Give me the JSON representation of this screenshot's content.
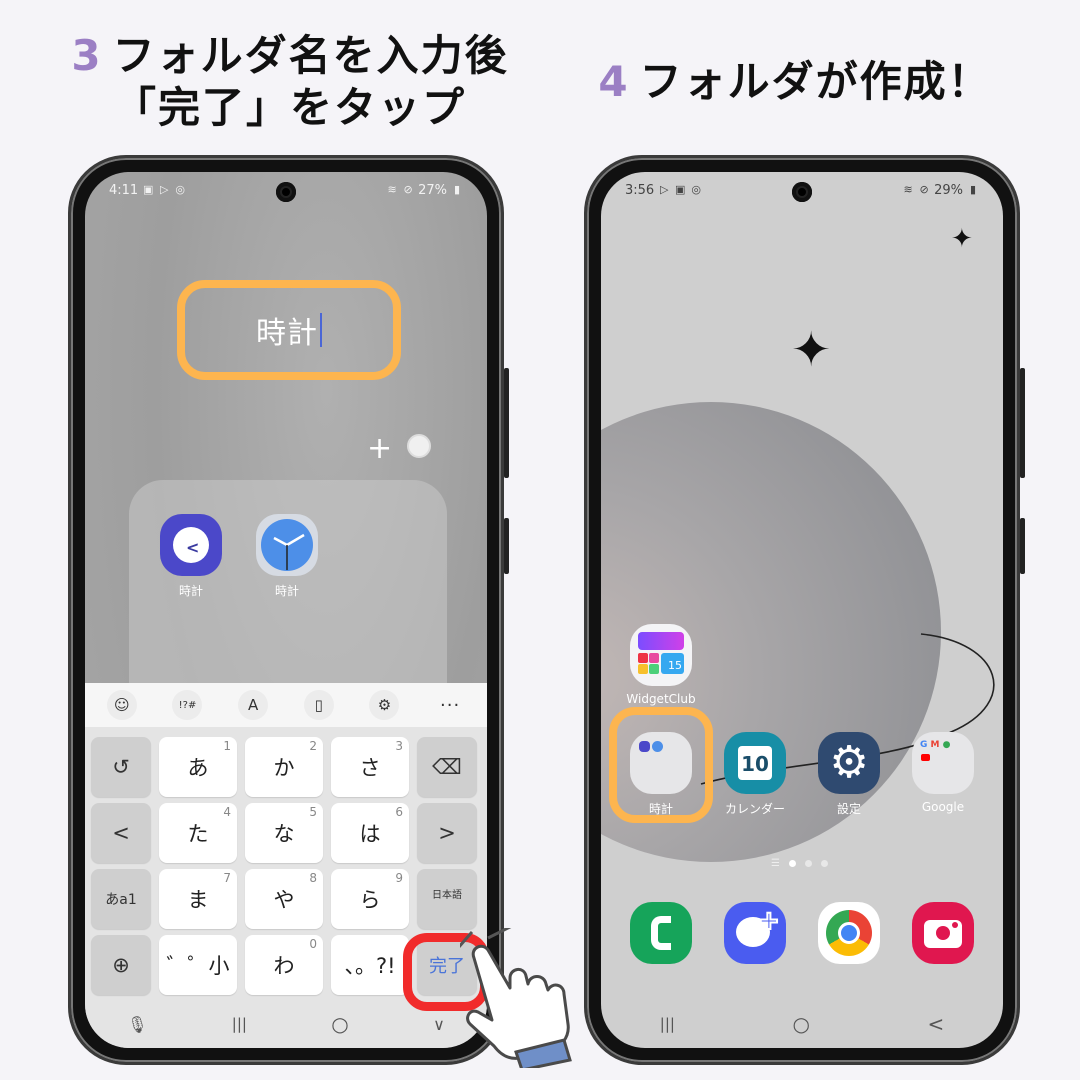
{
  "steps": [
    {
      "number": "3",
      "title_line1": "フォルダ名を入力後",
      "title_line2": "「完了」をタップ"
    },
    {
      "number": "4",
      "title": "フォルダが作成！"
    }
  ],
  "colors": {
    "accent_number": "#9b7fc4",
    "highlight_orange": "#fdb54f",
    "highlight_red": "#f12b2b",
    "key_done_blue": "#4a74d8"
  },
  "left_phone": {
    "status": {
      "time": "4:11",
      "left_icons": [
        "gallery-icon",
        "play-store-icon",
        "alarm-icon"
      ],
      "right_icons": [
        "wifi-icon",
        "do-not-disturb-icon"
      ],
      "battery": "27%"
    },
    "folder_name_input": {
      "value": "時計"
    },
    "folder_controls": {
      "add": "+",
      "color": "color-picker"
    },
    "folder_apps": [
      {
        "label": "時計",
        "icon": "samsung-clock-icon"
      },
      {
        "label": "時計",
        "icon": "google-clock-icon"
      }
    ],
    "keyboard_toolbar": [
      "emoji-icon",
      "symbols-icon",
      "translate-icon",
      "clipboard-icon",
      "settings-icon",
      "more-icon"
    ],
    "keyboard_toolbar_symbols": {
      "emoji": "☺",
      "symbols": "!?#",
      "translate": "A",
      "clipboard": "▯",
      "settings": "⚙",
      "more": "···"
    },
    "keys": [
      {
        "label": "↺",
        "sub": "",
        "type": "side",
        "name": "undo-key"
      },
      {
        "label": "あ",
        "sub": "1"
      },
      {
        "label": "か",
        "sub": "2"
      },
      {
        "label": "さ",
        "sub": "3"
      },
      {
        "label": "⌫",
        "sub": "",
        "type": "side",
        "name": "backspace-key"
      },
      {
        "label": "<",
        "sub": "",
        "type": "side",
        "name": "cursor-left-key"
      },
      {
        "label": "た",
        "sub": "4"
      },
      {
        "label": "な",
        "sub": "5"
      },
      {
        "label": "は",
        "sub": "6"
      },
      {
        "label": ">",
        "sub": "",
        "type": "side",
        "name": "cursor-right-key"
      },
      {
        "label": "あa1",
        "sub": "",
        "type": "side",
        "name": "mode-key"
      },
      {
        "label": "ま",
        "sub": "7"
      },
      {
        "label": "や",
        "sub": "8"
      },
      {
        "label": "ら",
        "sub": "9"
      },
      {
        "label": "日本語",
        "sub": "",
        "type": "side",
        "name": "space-key"
      },
      {
        "label": "⊕",
        "sub": "",
        "type": "side",
        "name": "language-key"
      },
      {
        "label": "゛゜小",
        "sub": ""
      },
      {
        "label": "わ",
        "sub": "0"
      },
      {
        "label": "、。?!",
        "sub": ""
      },
      {
        "label": "完了",
        "sub": "",
        "type": "side done",
        "name": "done-key"
      }
    ],
    "nav": {
      "mic": "🎙",
      "recents": "|||",
      "home": "○",
      "hide_keyboard": "∨"
    }
  },
  "right_phone": {
    "status": {
      "time": "3:56",
      "left_icons": [
        "play-store-icon",
        "gallery-icon",
        "alarm-icon"
      ],
      "right_icons": [
        "wifi-icon",
        "do-not-disturb-icon"
      ],
      "battery": "29%"
    },
    "home_apps": [
      {
        "label": "WidgetClub",
        "icon": "widgetclub-icon",
        "badge": "15"
      },
      {
        "label": "時計",
        "icon": "folder-icon"
      },
      {
        "label": "カレンダー",
        "icon": "calendar-icon",
        "badge": "10"
      },
      {
        "label": "設定",
        "icon": "settings-icon"
      },
      {
        "label": "Google",
        "icon": "google-folder-icon"
      }
    ],
    "page_indicator": {
      "pages": 3,
      "active": 1
    },
    "dock": [
      "phone-icon",
      "messages-icon",
      "chrome-icon",
      "camera-icon"
    ],
    "nav": {
      "recents": "|||",
      "home": "○",
      "back": "<"
    }
  }
}
